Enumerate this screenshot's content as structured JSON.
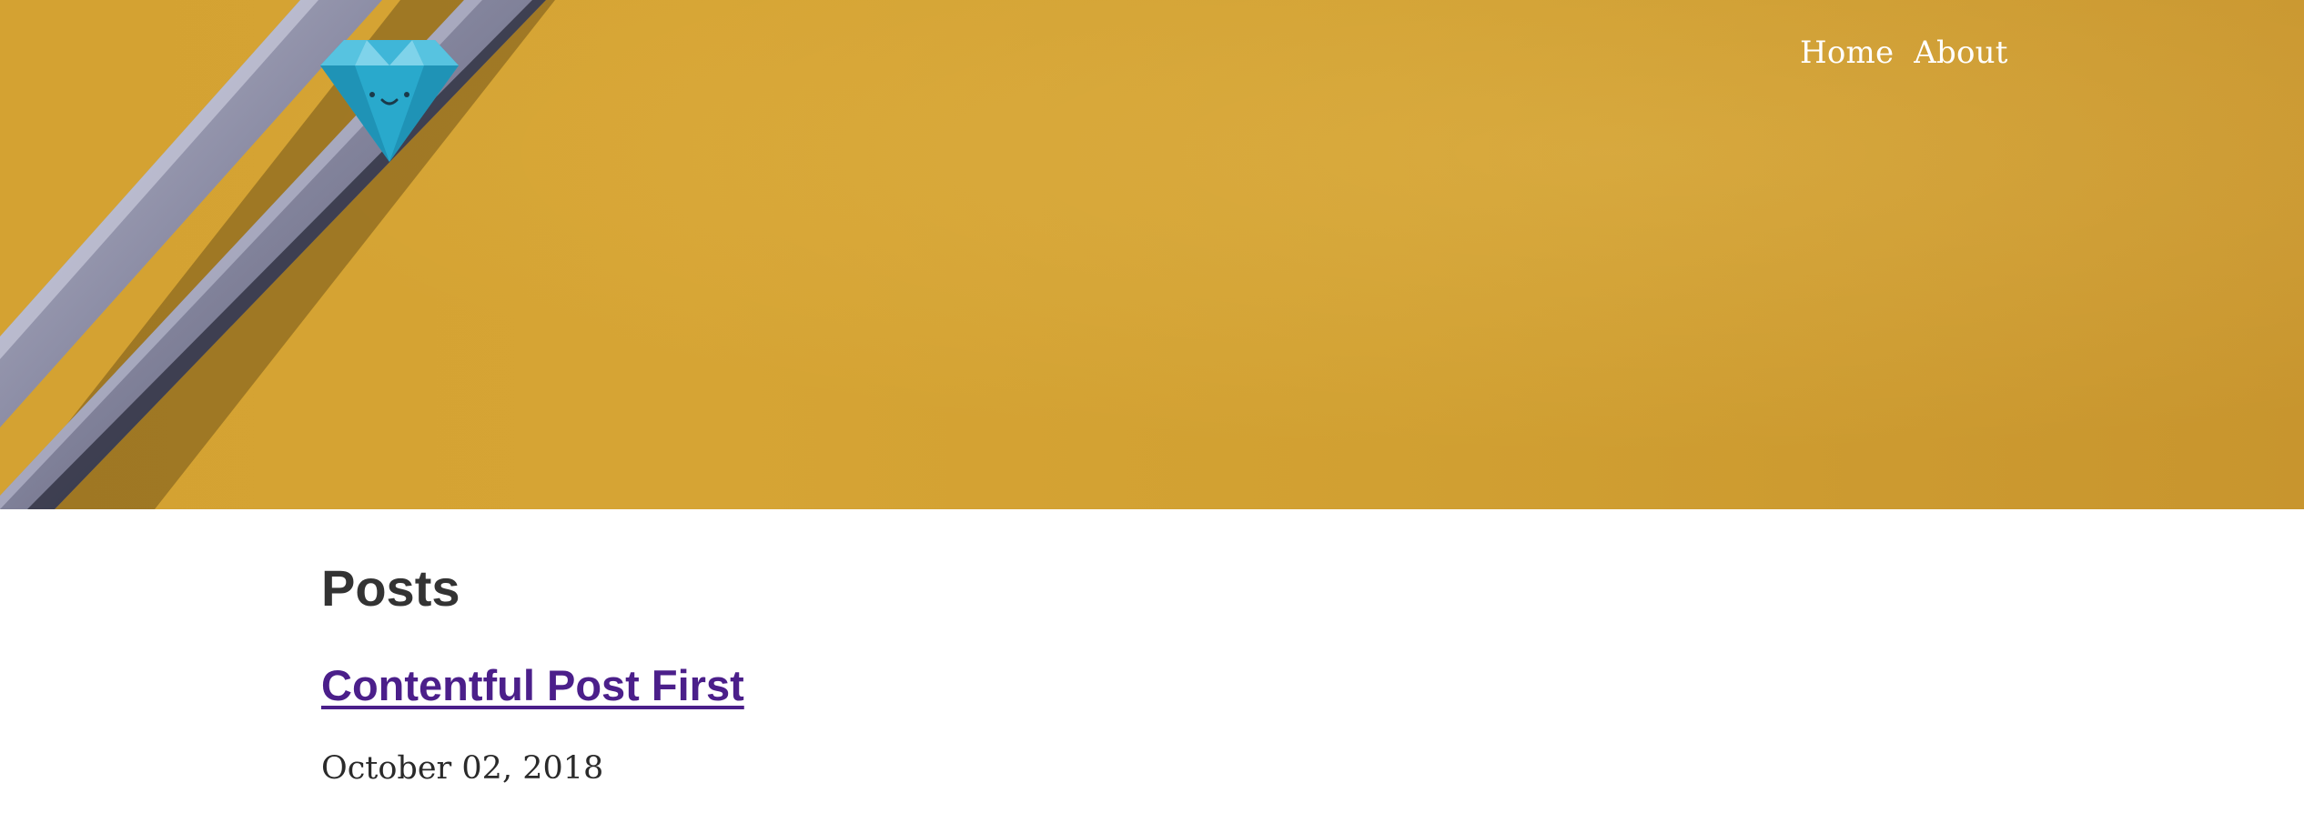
{
  "header": {
    "logo_icon": "diamond-logo-icon",
    "background_image": "yellow-pencils-photo",
    "nav": [
      {
        "label": "Home"
      },
      {
        "label": "About"
      }
    ]
  },
  "main": {
    "section_title": "Posts",
    "posts": [
      {
        "title": "Contentful Post First",
        "date": "October 02, 2018"
      }
    ]
  },
  "colors": {
    "hero_yellow": "#d4a232",
    "link_purple": "#4b1f8a",
    "heading": "#333333",
    "logo_blue": "#29a9cc"
  }
}
